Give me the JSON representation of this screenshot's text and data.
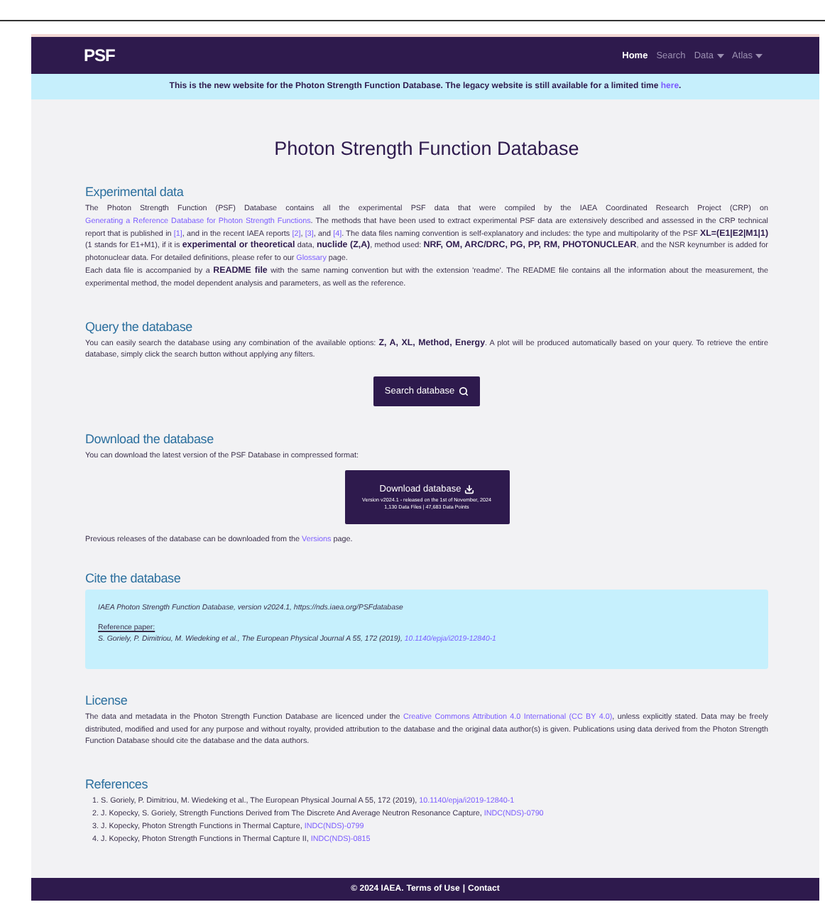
{
  "navbar": {
    "brand": "PSF",
    "items": [
      {
        "label": "Home",
        "kind": "link",
        "selected": true
      },
      {
        "label": "Search",
        "kind": "link",
        "selected": false
      },
      {
        "label": "Data",
        "kind": "dropdown",
        "selected": false
      },
      {
        "label": "Atlas",
        "kind": "dropdown",
        "selected": false
      }
    ]
  },
  "banner": [
    {
      "kind": "text",
      "text": "This is the new website for the Photon Strength Function Database. The legacy website is still available for a limited time "
    },
    {
      "kind": "link",
      "text": "here"
    },
    {
      "kind": "text",
      "text": "."
    }
  ],
  "title": "Photon Strength Function Database",
  "experimental": {
    "heading": "Experimental data",
    "paragraphs": [
      [
        {
          "kind": "text",
          "text": "The Photon Strength Function (PSF) Database contains all the experimental PSF data that were compiled by the IAEA Coordinated Research Project (CRP) on "
        },
        {
          "kind": "link",
          "text": "Generating a Reference Database for Photon Strength Functions"
        },
        {
          "kind": "text",
          "text": ". The methods that have been used to extract experimental PSF data are extensively described and assessed in the CRP technical report that is published in "
        },
        {
          "kind": "link",
          "text": "[1]"
        },
        {
          "kind": "text",
          "text": ", and in the recent IAEA reports "
        },
        {
          "kind": "link",
          "text": "[2]"
        },
        {
          "kind": "text",
          "text": ", "
        },
        {
          "kind": "link",
          "text": "[3]"
        },
        {
          "kind": "text",
          "text": ", and "
        },
        {
          "kind": "link",
          "text": "[4]"
        },
        {
          "kind": "text",
          "text": ". The data files naming convention is self-explanatory and includes: the type and multipolarity of the PSF "
        },
        {
          "kind": "bold",
          "text": "XL=(E1|E2|M1|1)"
        },
        {
          "kind": "text",
          "text": " (1 stands for E1+M1), if it is "
        },
        {
          "kind": "bold",
          "text": "experimental or theoretical"
        },
        {
          "kind": "text",
          "text": " data, "
        },
        {
          "kind": "bold",
          "text": "nuclide (Z,A)"
        },
        {
          "kind": "text",
          "text": ", method used: "
        },
        {
          "kind": "bold",
          "text": "NRF, OM, ARC/DRC, PG, PP, RM, PHOTONUCLEAR"
        },
        {
          "kind": "text",
          "text": ", and the NSR keynumber is added for photonuclear data. For detailed definitions, please refer to our "
        },
        {
          "kind": "link",
          "text": "Glossary"
        },
        {
          "kind": "text",
          "text": " page."
        }
      ],
      [
        {
          "kind": "text",
          "text": "Each data file is accompanied by a "
        },
        {
          "kind": "bold",
          "text": "README file"
        },
        {
          "kind": "text",
          "text": " with the same naming convention but with the extension 'readme'. The README file contains all the information about the measurement, the experimental method, the model dependent analysis and parameters, as well as the reference."
        }
      ]
    ]
  },
  "query": {
    "heading": "Query the database",
    "paragraph": [
      {
        "kind": "text",
        "text": "You can easily search the database using any combination of the available options: "
      },
      {
        "kind": "bold",
        "text": "Z, A, XL, Method, Energy"
      },
      {
        "kind": "text",
        "text": ". A plot will be produced automatically based on your query. To retrieve the entire database, simply click the search button without applying any filters."
      }
    ],
    "button": "Search database"
  },
  "download": {
    "heading": "Download the database",
    "paragraph": [
      {
        "kind": "text",
        "text": "You can download the latest version of the PSF Database in compressed format:"
      }
    ],
    "button": {
      "label": "Download database",
      "version": "Version v2024.1 - released on the 1st of November, 2024",
      "stats": "1,130 Data Files | 47,683 Data Points"
    },
    "note": [
      {
        "kind": "text",
        "text": "Previous releases of the database can be downloaded from the "
      },
      {
        "kind": "link",
        "text": "Versions"
      },
      {
        "kind": "text",
        "text": " page."
      }
    ]
  },
  "cite": {
    "heading": "Cite the database",
    "citation": "IAEA Photon Strength Function Database, version v2024.1, https://nds.iaea.org/PSFdatabase",
    "reference_label": "Reference paper:",
    "reference": [
      {
        "kind": "text",
        "text": "S. Goriely, P. Dimitriou, M. Wiedeking et al., The European Physical Journal A 55, 172 (2019), "
      },
      {
        "kind": "link",
        "text": "10.1140/epja/i2019-12840-1"
      }
    ]
  },
  "license": {
    "heading": "License",
    "paragraph": [
      {
        "kind": "text",
        "text": "The data and metadata in the Photon Strength Function Database are licenced under the "
      },
      {
        "kind": "link",
        "text": "Creative Commons Attribution 4.0 International (CC BY 4.0)"
      },
      {
        "kind": "text",
        "text": ", unless explicitly stated. Data may be freely distributed, modified and used for any purpose and without royalty, provided attribution to the database and the original data author(s) is given. Publications using data derived from the Photon Strength Function Database should cite the database and the data authors."
      }
    ]
  },
  "references": {
    "heading": "References",
    "items": [
      {
        "number": "1.",
        "segments": [
          {
            "kind": "text",
            "text": "S. Goriely, P. Dimitriou, M. Wiedeking et al., The European Physical Journal A 55, 172 (2019), "
          },
          {
            "kind": "link",
            "text": "10.1140/epja/i2019-12840-1"
          }
        ]
      },
      {
        "number": "2.",
        "segments": [
          {
            "kind": "text",
            "text": "J. Kopecky, S. Goriely, Strength Functions Derived from The Discrete And Average Neutron Resonance Capture, "
          },
          {
            "kind": "link",
            "text": "INDC(NDS)-0790"
          }
        ]
      },
      {
        "number": "3.",
        "segments": [
          {
            "kind": "text",
            "text": "J. Kopecky, Photon Strength Functions in Thermal Capture, "
          },
          {
            "kind": "link",
            "text": "INDC(NDS)-0799"
          }
        ]
      },
      {
        "number": "4.",
        "segments": [
          {
            "kind": "text",
            "text": "J. Kopecky, Photon Strength Functions in Thermal Capture II, "
          },
          {
            "kind": "link",
            "text": "INDC(NDS)-0815"
          }
        ]
      }
    ]
  },
  "footer": {
    "copyright": "© 2024 IAEA.",
    "links": [
      "Terms of Use",
      "Contact"
    ],
    "separator": "|"
  }
}
